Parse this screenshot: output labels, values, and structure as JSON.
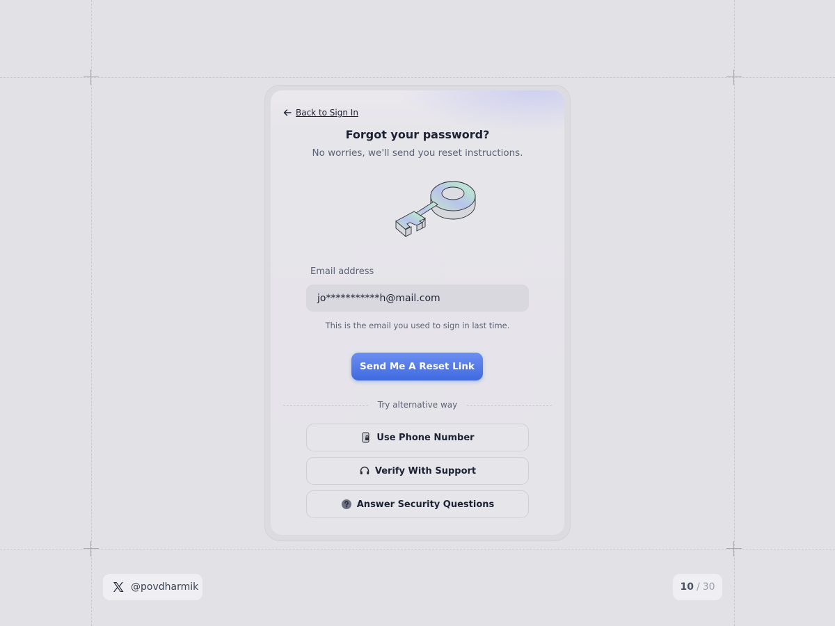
{
  "card": {
    "back_link": "Back to Sign In",
    "title": "Forgot your password?",
    "subtitle": "No worries, we'll send you reset instructions.",
    "email_label": "Email address",
    "email_value": "jo***********h@mail.com",
    "hint": "This is the email you used to sign in last time.",
    "reset_button": "Send Me A Reset Link",
    "divider_text": "Try alternative way",
    "alternatives": [
      {
        "label": "Use Phone Number",
        "icon": "phone-lock-icon"
      },
      {
        "label": "Verify With Support",
        "icon": "headset-icon"
      },
      {
        "label": "Answer Security Questions",
        "icon": "question-icon"
      }
    ]
  },
  "footer": {
    "social_handle": "@povdharmik",
    "social_icon": "x-logo-icon",
    "page_current": "10",
    "page_separator": "/",
    "page_total": "30"
  },
  "colors": {
    "background": "#e2e1e6",
    "primary": "#4a74e6",
    "text": "#1c2233",
    "muted": "#5b6275"
  }
}
